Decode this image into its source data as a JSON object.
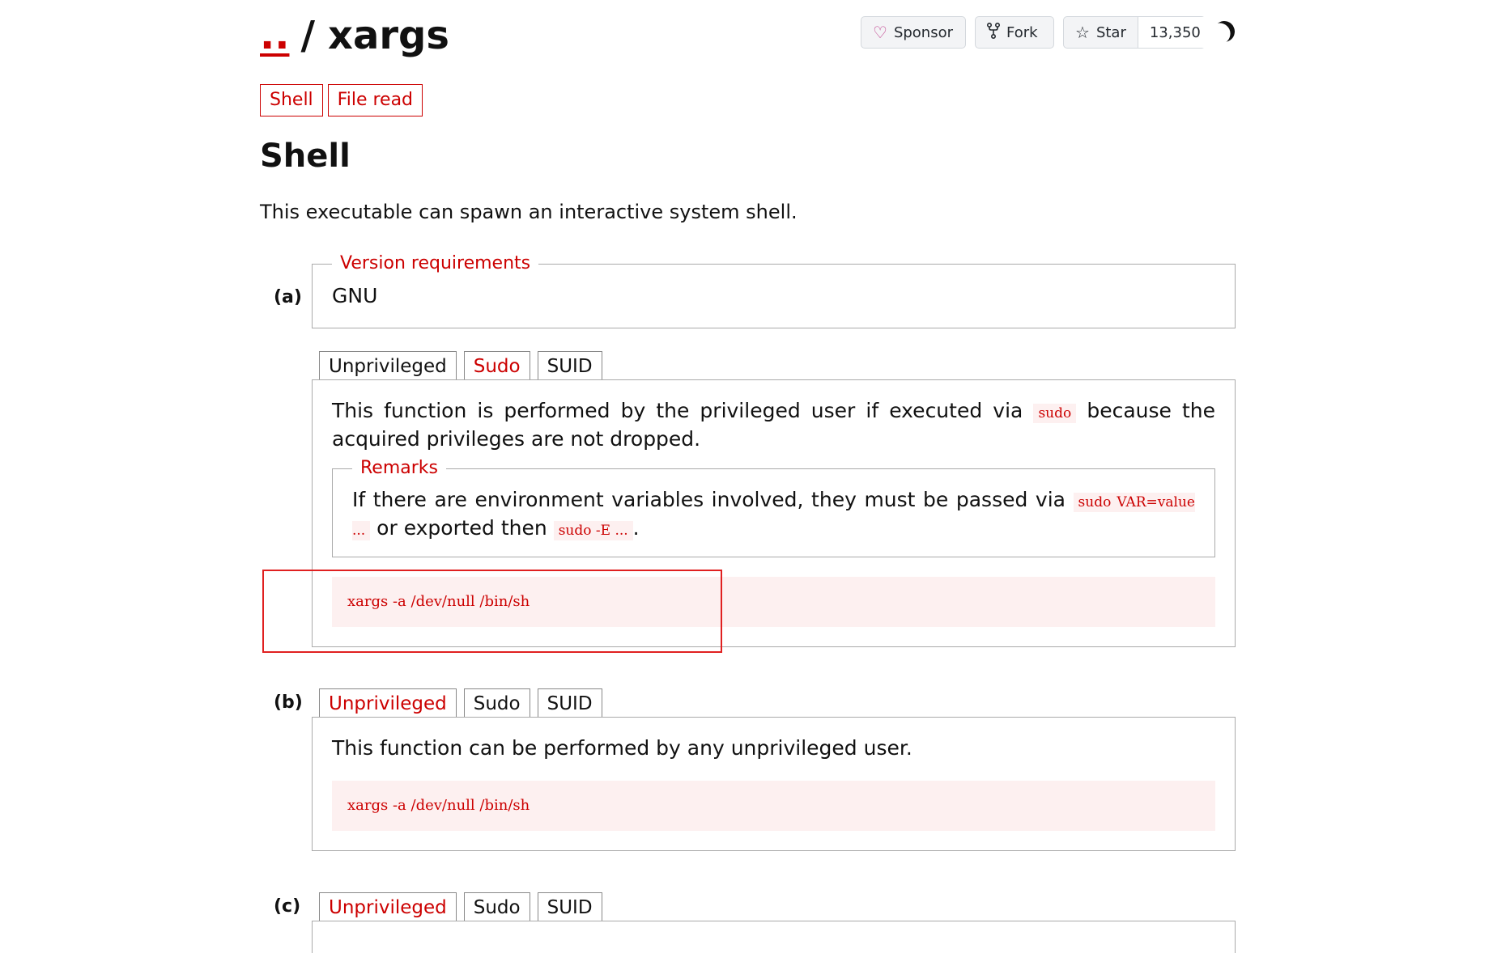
{
  "header": {
    "crumb": "..",
    "separator": "/",
    "title": "xargs",
    "sponsor_label": "Sponsor",
    "fork_label": "Fork",
    "star_label": "Star",
    "star_count": "13,350",
    "icons": {
      "sponsor": "heart-icon",
      "fork": "fork-icon",
      "star": "star-icon",
      "theme": "moon-icon"
    },
    "accent_color": "#cc0000"
  },
  "tags": [
    "Shell",
    "File read"
  ],
  "section": {
    "heading": "Shell",
    "description": "This executable can spawn an interactive system shell."
  },
  "example_a": {
    "label": "(a)",
    "version_legend": "Version requirements",
    "version_value": "GNU",
    "tabs": [
      "Unprivileged",
      "Sudo",
      "SUID"
    ],
    "active_tab": "Sudo",
    "text_before": "This function is performed by the privileged user if executed via",
    "inline_code_1": "sudo",
    "text_after": "because the acquired privileges are not dropped.",
    "remarks_legend": "Remarks",
    "remarks_before": "If there are environment variables involved, they must be passed via",
    "remarks_code_1": "sudo VAR=value ...",
    "remarks_mid": "or exported then",
    "remarks_code_2": "sudo -E ...",
    "remarks_end": ".",
    "command": "xargs -a /dev/null /bin/sh"
  },
  "example_b": {
    "label": "(b)",
    "tabs": [
      "Unprivileged",
      "Sudo",
      "SUID"
    ],
    "active_tab": "Unprivileged",
    "text": "This function can be performed by any unprivileged user.",
    "command": "xargs -a /dev/null /bin/sh"
  },
  "example_c": {
    "label": "(c)",
    "tabs": [
      "Unprivileged",
      "Sudo",
      "SUID"
    ],
    "active_tab": "Unprivileged"
  }
}
